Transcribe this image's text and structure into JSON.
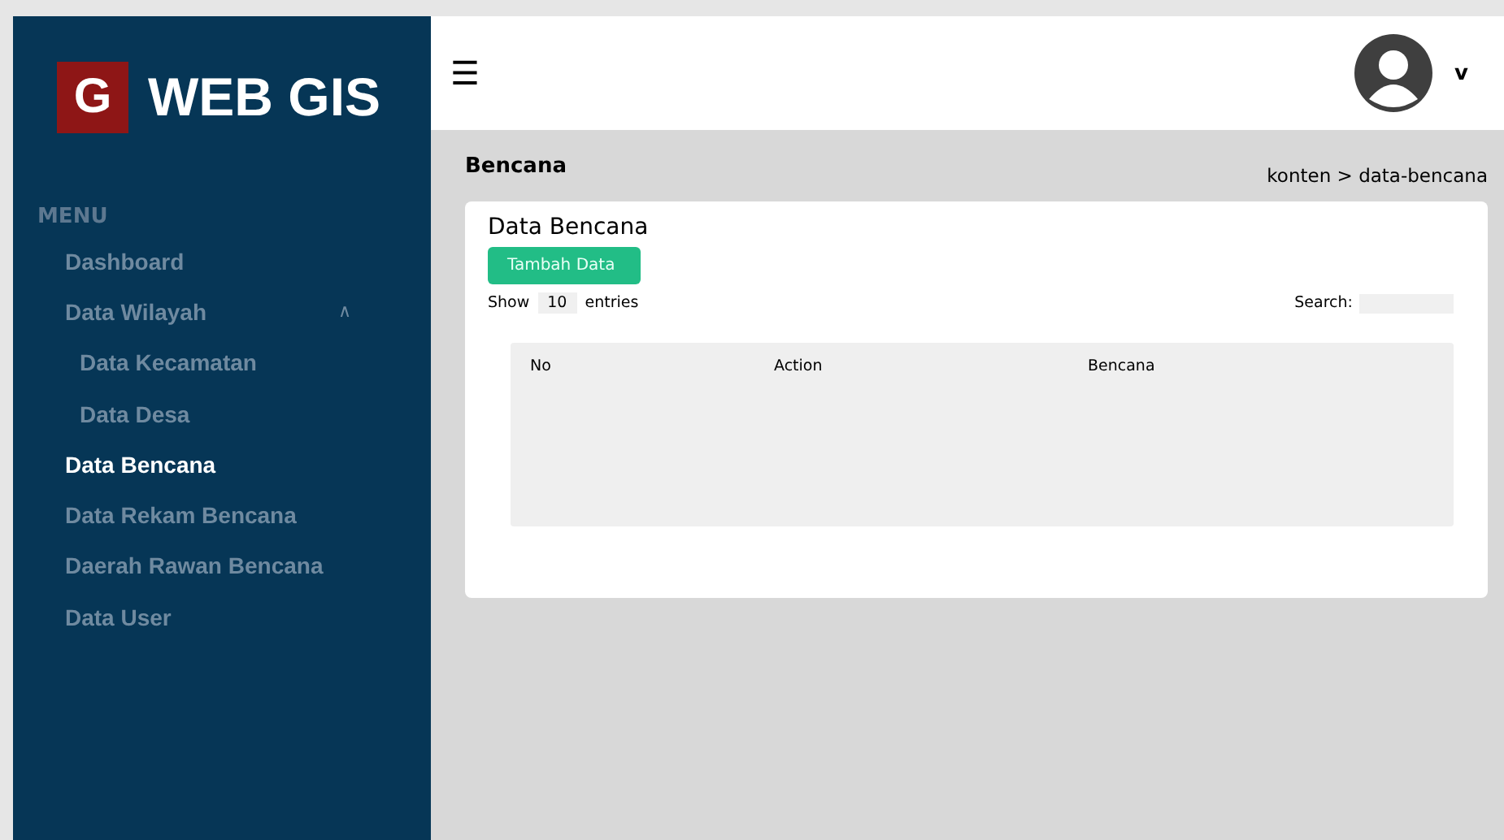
{
  "logo": {
    "letter": "G",
    "title": "WEB GIS"
  },
  "sidebar": {
    "heading": "MENU",
    "items": [
      {
        "label": "Dashboard",
        "selected": false
      },
      {
        "label": "Data Wilayah",
        "selected": false,
        "expanded": true,
        "toggle": "∧",
        "children": [
          {
            "label": "Data Kecamatan",
            "selected": false
          },
          {
            "label": "Data Desa",
            "selected": false
          }
        ]
      },
      {
        "label": "Data Bencana",
        "selected": true
      },
      {
        "label": "Data Rekam Bencana",
        "selected": false
      },
      {
        "label": "Daerah Rawan Bencana",
        "selected": false
      },
      {
        "label": "Data User",
        "selected": false
      }
    ]
  },
  "topbar": {
    "menu_glyph": "☰",
    "user": "v"
  },
  "page": {
    "title": "Bencana",
    "breadcrumb": "konten > data-bencana"
  },
  "card": {
    "title": "Data Bencana",
    "add_button": "Tambah Data",
    "show_label": "Show",
    "page_size": "10",
    "entries_label": "entries",
    "search_label": "Search:",
    "table": {
      "columns": [
        "No",
        "Action",
        "Bencana"
      ]
    }
  }
}
